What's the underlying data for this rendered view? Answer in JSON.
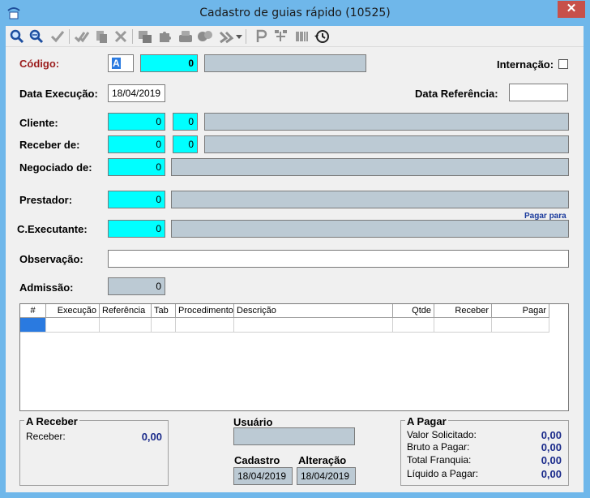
{
  "window": {
    "title": "Cadastro de guias rápido (10525)",
    "close": "✕"
  },
  "toolbar": {
    "icons": [
      "search-icon",
      "search-next-icon",
      "check-icon",
      "approve-icon",
      "copy-icon",
      "cancel-icon",
      "window-icon",
      "puzzle-icon",
      "stack-icon",
      "gears-icon",
      "tools-icon",
      "p-icon",
      "tree-icon",
      "barcode-icon",
      "history-icon"
    ]
  },
  "form": {
    "codigo_label": "Código:",
    "codigo_letter": "A",
    "codigo_value": "0",
    "internacao_label": "Internação:",
    "data_execucao_label": "Data Execução:",
    "data_execucao_value": "18/04/2019",
    "data_referencia_label": "Data Referência:",
    "cliente_label": "Cliente:",
    "cliente_value": "0",
    "cliente_sub": "0",
    "receber_label": "Receber de:",
    "receber_value": "0",
    "receber_sub": "0",
    "negociado_label": "Negociado de:",
    "negociado_value": "0",
    "prestador_label": "Prestador:",
    "prestador_value": "0",
    "pagar_para_link": "Pagar para",
    "executante_label": "C.Executante:",
    "executante_value": "0",
    "observacao_label": "Observação:",
    "admissao_label": "Admissão:",
    "admissao_value": "0"
  },
  "grid": {
    "columns": [
      "#",
      "Execução",
      "Referência",
      "Tab",
      "Procedimento",
      "Descrição",
      "Qtde",
      "Receber",
      "Pagar"
    ]
  },
  "a_receber": {
    "title": "A Receber",
    "label": "Receber:",
    "value": "0,00"
  },
  "usuario": {
    "title": "Usuário",
    "cadastro_label": "Cadastro",
    "cadastro_value": "18/04/2019",
    "alteracao_label": "Alteração",
    "alteracao_value": "18/04/2019"
  },
  "a_pagar": {
    "title": "A Pagar",
    "rows": [
      {
        "label": "Valor Solicitado:",
        "value": "0,00"
      },
      {
        "label": "Bruto a Pagar:",
        "value": "0,00"
      },
      {
        "label": "Total Franquia:",
        "value": "0,00"
      },
      {
        "label": "Líquido a Pagar:",
        "value": "0,00"
      }
    ]
  }
}
